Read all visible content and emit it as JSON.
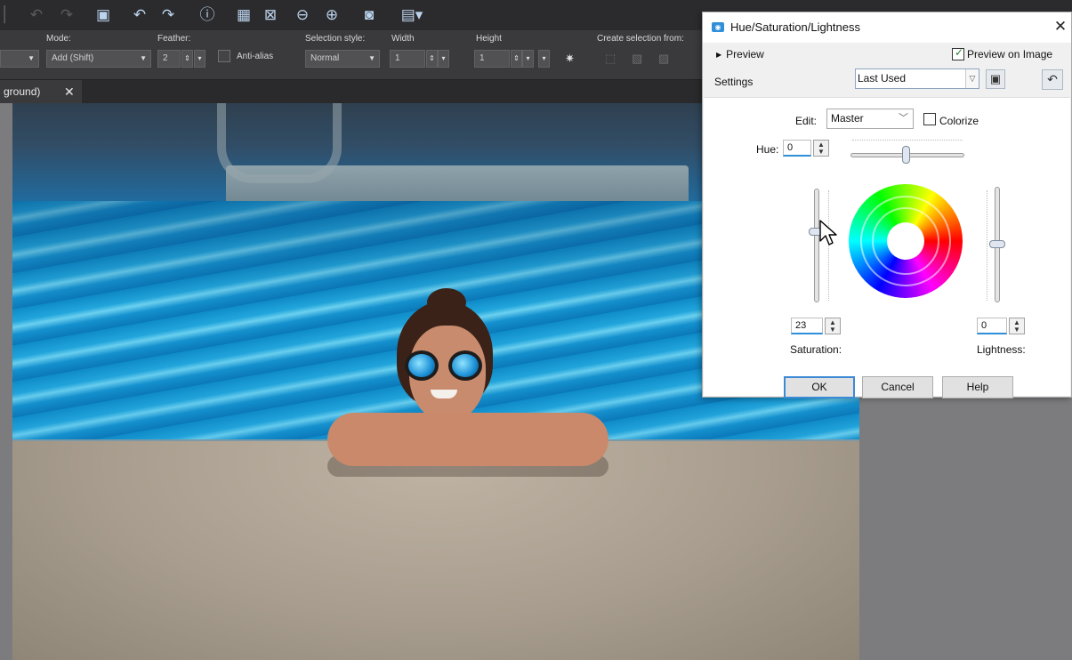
{
  "toolbar": {
    "icons": [
      "undo-disabled-icon",
      "redo-disabled-icon",
      "save-icon",
      "undo-icon",
      "redo-icon",
      "info-icon",
      "image-info-icon",
      "fit-icon",
      "zoom-out-icon",
      "zoom-in-icon",
      "actual-size-icon",
      "paste-icon"
    ]
  },
  "options": {
    "mode_label": "Mode:",
    "mode_value": "Add (Shift)",
    "feather_label": "Feather:",
    "feather_value": "2",
    "antialias_label": "Anti-alias",
    "selection_style_label": "Selection style:",
    "selection_style_value": "Normal",
    "width_label": "Width",
    "width_value": "1",
    "height_label": "Height",
    "height_value": "1",
    "create_selection_label": "Create selection from:"
  },
  "document_tab": {
    "label": "ground)",
    "close": "✕"
  },
  "dialog": {
    "title": "Hue/Saturation/Lightness",
    "close": "✕",
    "preview_label": "Preview",
    "preview_on_image_label": "Preview on Image",
    "preview_on_image_checked": true,
    "settings_label": "Settings",
    "settings_value": "Last Used",
    "edit_label": "Edit:",
    "edit_value": "Master",
    "colorize_label": "Colorize",
    "colorize_checked": false,
    "hue_label": "Hue:",
    "hue_value": "0",
    "saturation_value": "23",
    "saturation_label": "Saturation:",
    "lightness_value": "0",
    "lightness_label": "Lightness:",
    "ok_label": "OK",
    "cancel_label": "Cancel",
    "help_label": "Help"
  },
  "colors": {
    "accent": "#2f8fd8",
    "toolbar_bg": "#2b2b2d",
    "workspace_bg": "#7c7c7e"
  }
}
